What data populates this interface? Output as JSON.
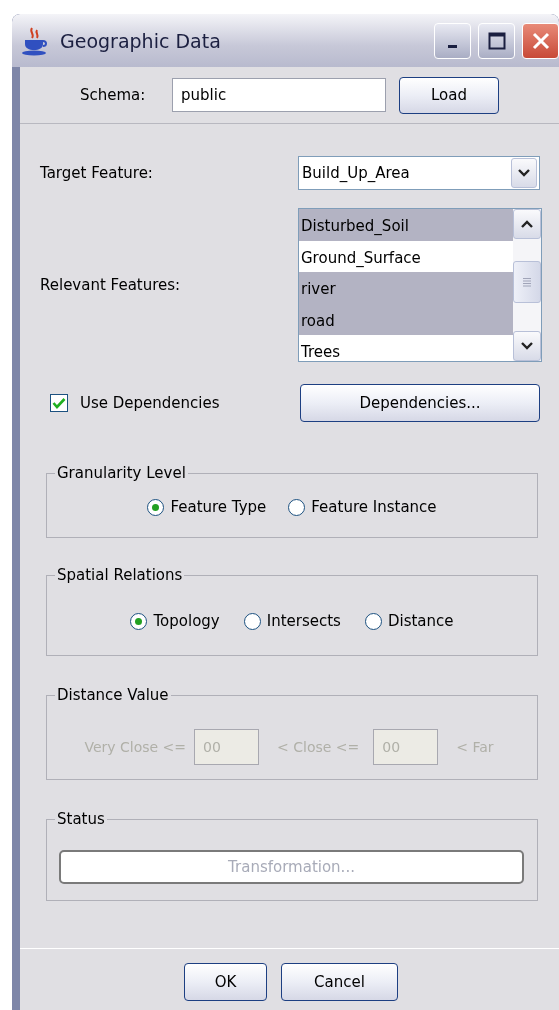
{
  "window": {
    "title": "Geographic Data"
  },
  "schema": {
    "label": "Schema:",
    "value": "public",
    "button": "Load"
  },
  "target_feature": {
    "label": "Target Feature:",
    "value": "Build_Up_Area"
  },
  "relevant_features": {
    "label": "Relevant Features:",
    "items": [
      {
        "label": "Disturbed_Soil",
        "selected": true
      },
      {
        "label": "Ground_Surface",
        "selected": false
      },
      {
        "label": "river",
        "selected": true
      },
      {
        "label": "road",
        "selected": true
      },
      {
        "label": "Trees",
        "selected": false
      }
    ]
  },
  "use_dependencies": {
    "label": "Use Dependencies",
    "checked": true
  },
  "dependencies_button": "Dependencies...",
  "granularity": {
    "title": "Granularity Level",
    "options": [
      {
        "label": "Feature Type",
        "selected": true
      },
      {
        "label": "Feature Instance",
        "selected": false
      }
    ]
  },
  "spatial_relations": {
    "title": "Spatial Relations",
    "options": [
      {
        "label": "Topology",
        "selected": true
      },
      {
        "label": "Intersects",
        "selected": false
      },
      {
        "label": "Distance",
        "selected": false
      }
    ]
  },
  "distance_value": {
    "title": "Distance Value",
    "disabled": true,
    "parts": [
      {
        "kind": "text",
        "text": "Very Close <="
      },
      {
        "kind": "field",
        "value": "00"
      },
      {
        "kind": "text",
        "text": "< Close <="
      },
      {
        "kind": "field",
        "value": "00"
      },
      {
        "kind": "text",
        "text": "< Far"
      }
    ]
  },
  "status": {
    "title": "Status",
    "message": "Transformation..."
  },
  "buttons": [
    "OK",
    "Cancel"
  ]
}
